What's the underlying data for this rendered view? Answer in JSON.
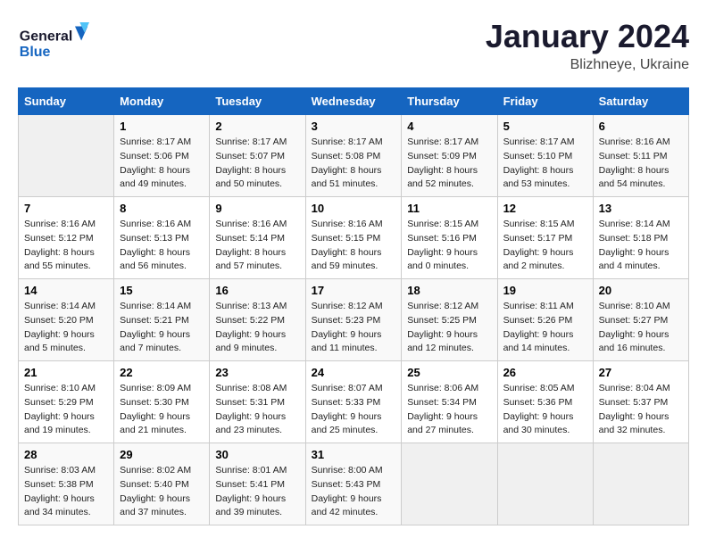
{
  "header": {
    "logo_general": "General",
    "logo_blue": "Blue",
    "month": "January 2024",
    "location": "Blizhneye, Ukraine"
  },
  "weekdays": [
    "Sunday",
    "Monday",
    "Tuesday",
    "Wednesday",
    "Thursday",
    "Friday",
    "Saturday"
  ],
  "weeks": [
    [
      {
        "day": "",
        "sunrise": "",
        "sunset": "",
        "daylight": ""
      },
      {
        "day": "1",
        "sunrise": "8:17 AM",
        "sunset": "5:06 PM",
        "daylight": "8 hours and 49 minutes."
      },
      {
        "day": "2",
        "sunrise": "8:17 AM",
        "sunset": "5:07 PM",
        "daylight": "8 hours and 50 minutes."
      },
      {
        "day": "3",
        "sunrise": "8:17 AM",
        "sunset": "5:08 PM",
        "daylight": "8 hours and 51 minutes."
      },
      {
        "day": "4",
        "sunrise": "8:17 AM",
        "sunset": "5:09 PM",
        "daylight": "8 hours and 52 minutes."
      },
      {
        "day": "5",
        "sunrise": "8:17 AM",
        "sunset": "5:10 PM",
        "daylight": "8 hours and 53 minutes."
      },
      {
        "day": "6",
        "sunrise": "8:16 AM",
        "sunset": "5:11 PM",
        "daylight": "8 hours and 54 minutes."
      }
    ],
    [
      {
        "day": "7",
        "sunrise": "8:16 AM",
        "sunset": "5:12 PM",
        "daylight": "8 hours and 55 minutes."
      },
      {
        "day": "8",
        "sunrise": "8:16 AM",
        "sunset": "5:13 PM",
        "daylight": "8 hours and 56 minutes."
      },
      {
        "day": "9",
        "sunrise": "8:16 AM",
        "sunset": "5:14 PM",
        "daylight": "8 hours and 57 minutes."
      },
      {
        "day": "10",
        "sunrise": "8:16 AM",
        "sunset": "5:15 PM",
        "daylight": "8 hours and 59 minutes."
      },
      {
        "day": "11",
        "sunrise": "8:15 AM",
        "sunset": "5:16 PM",
        "daylight": "9 hours and 0 minutes."
      },
      {
        "day": "12",
        "sunrise": "8:15 AM",
        "sunset": "5:17 PM",
        "daylight": "9 hours and 2 minutes."
      },
      {
        "day": "13",
        "sunrise": "8:14 AM",
        "sunset": "5:18 PM",
        "daylight": "9 hours and 4 minutes."
      }
    ],
    [
      {
        "day": "14",
        "sunrise": "8:14 AM",
        "sunset": "5:20 PM",
        "daylight": "9 hours and 5 minutes."
      },
      {
        "day": "15",
        "sunrise": "8:14 AM",
        "sunset": "5:21 PM",
        "daylight": "9 hours and 7 minutes."
      },
      {
        "day": "16",
        "sunrise": "8:13 AM",
        "sunset": "5:22 PM",
        "daylight": "9 hours and 9 minutes."
      },
      {
        "day": "17",
        "sunrise": "8:12 AM",
        "sunset": "5:23 PM",
        "daylight": "9 hours and 11 minutes."
      },
      {
        "day": "18",
        "sunrise": "8:12 AM",
        "sunset": "5:25 PM",
        "daylight": "9 hours and 12 minutes."
      },
      {
        "day": "19",
        "sunrise": "8:11 AM",
        "sunset": "5:26 PM",
        "daylight": "9 hours and 14 minutes."
      },
      {
        "day": "20",
        "sunrise": "8:10 AM",
        "sunset": "5:27 PM",
        "daylight": "9 hours and 16 minutes."
      }
    ],
    [
      {
        "day": "21",
        "sunrise": "8:10 AM",
        "sunset": "5:29 PM",
        "daylight": "9 hours and 19 minutes."
      },
      {
        "day": "22",
        "sunrise": "8:09 AM",
        "sunset": "5:30 PM",
        "daylight": "9 hours and 21 minutes."
      },
      {
        "day": "23",
        "sunrise": "8:08 AM",
        "sunset": "5:31 PM",
        "daylight": "9 hours and 23 minutes."
      },
      {
        "day": "24",
        "sunrise": "8:07 AM",
        "sunset": "5:33 PM",
        "daylight": "9 hours and 25 minutes."
      },
      {
        "day": "25",
        "sunrise": "8:06 AM",
        "sunset": "5:34 PM",
        "daylight": "9 hours and 27 minutes."
      },
      {
        "day": "26",
        "sunrise": "8:05 AM",
        "sunset": "5:36 PM",
        "daylight": "9 hours and 30 minutes."
      },
      {
        "day": "27",
        "sunrise": "8:04 AM",
        "sunset": "5:37 PM",
        "daylight": "9 hours and 32 minutes."
      }
    ],
    [
      {
        "day": "28",
        "sunrise": "8:03 AM",
        "sunset": "5:38 PM",
        "daylight": "9 hours and 34 minutes."
      },
      {
        "day": "29",
        "sunrise": "8:02 AM",
        "sunset": "5:40 PM",
        "daylight": "9 hours and 37 minutes."
      },
      {
        "day": "30",
        "sunrise": "8:01 AM",
        "sunset": "5:41 PM",
        "daylight": "9 hours and 39 minutes."
      },
      {
        "day": "31",
        "sunrise": "8:00 AM",
        "sunset": "5:43 PM",
        "daylight": "9 hours and 42 minutes."
      },
      {
        "day": "",
        "sunrise": "",
        "sunset": "",
        "daylight": ""
      },
      {
        "day": "",
        "sunrise": "",
        "sunset": "",
        "daylight": ""
      },
      {
        "day": "",
        "sunrise": "",
        "sunset": "",
        "daylight": ""
      }
    ]
  ],
  "labels": {
    "sunrise": "Sunrise:",
    "sunset": "Sunset:",
    "daylight": "Daylight:"
  }
}
